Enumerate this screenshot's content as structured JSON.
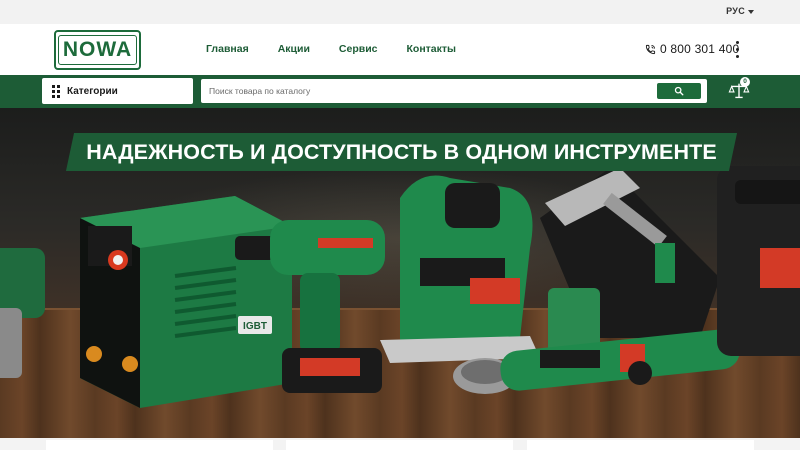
{
  "topbar": {
    "language": "РУС"
  },
  "header": {
    "logo_text": "NOWA",
    "nav": [
      {
        "label": "Главная"
      },
      {
        "label": "Акции"
      },
      {
        "label": "Сервис"
      },
      {
        "label": "Контакты"
      }
    ],
    "phone": "0 800 301 400"
  },
  "toolbar": {
    "categories_label": "Категории",
    "search_placeholder": "Поиск товара по каталогу",
    "compare_count": "0"
  },
  "hero": {
    "headline": "НАДЕЖНОСТЬ И ДОСТУПНОСТЬ В ОДНОМ ИНСТРУМЕНТЕ",
    "product_labels": {
      "welder_badge": "IGBT"
    }
  },
  "colors": {
    "brand_green": "#1d5c36",
    "accent_green": "#1d6b3b",
    "tool_green": "#1f7a45",
    "topbar_bg": "#f2f2f2"
  },
  "icons": [
    "phone-icon",
    "grid-dots-icon",
    "search-icon",
    "scales-icon",
    "chevron-down-icon",
    "kebab-menu-icon"
  ]
}
